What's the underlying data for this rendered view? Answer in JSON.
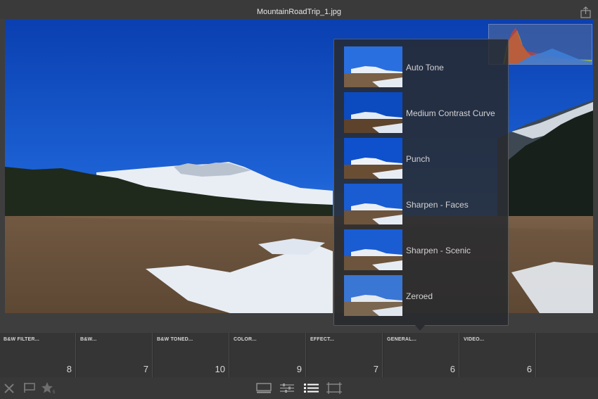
{
  "window": {
    "title": "MountainRoadTrip_1.jpg",
    "share_icon": "share-icon"
  },
  "presets": [
    {
      "label": "Auto Tone"
    },
    {
      "label": "Medium Contrast Curve"
    },
    {
      "label": "Punch"
    },
    {
      "label": "Sharpen - Faces"
    },
    {
      "label": "Sharpen - Scenic"
    },
    {
      "label": "Zeroed"
    }
  ],
  "categories": [
    {
      "label": "B&W FILTER...",
      "count": "8"
    },
    {
      "label": "B&W...",
      "count": "7"
    },
    {
      "label": "B&W TONED...",
      "count": "10"
    },
    {
      "label": "COLOR...",
      "count": "9"
    },
    {
      "label": "EFFECT...",
      "count": "7"
    },
    {
      "label": "GENERAL...",
      "count": "6"
    },
    {
      "label": "VIDEO...",
      "count": "6"
    }
  ],
  "toolbar": {
    "left_icons": [
      "reject-x-icon",
      "flag-icon",
      "star-rating-icon"
    ],
    "center_icons": [
      "loupe-view-icon",
      "adjust-sliders-icon",
      "presets-list-icon",
      "crop-icon"
    ]
  },
  "colors": {
    "accent": "#ffffff",
    "sky": "#1553c8",
    "panel": "#2e2e2e"
  }
}
